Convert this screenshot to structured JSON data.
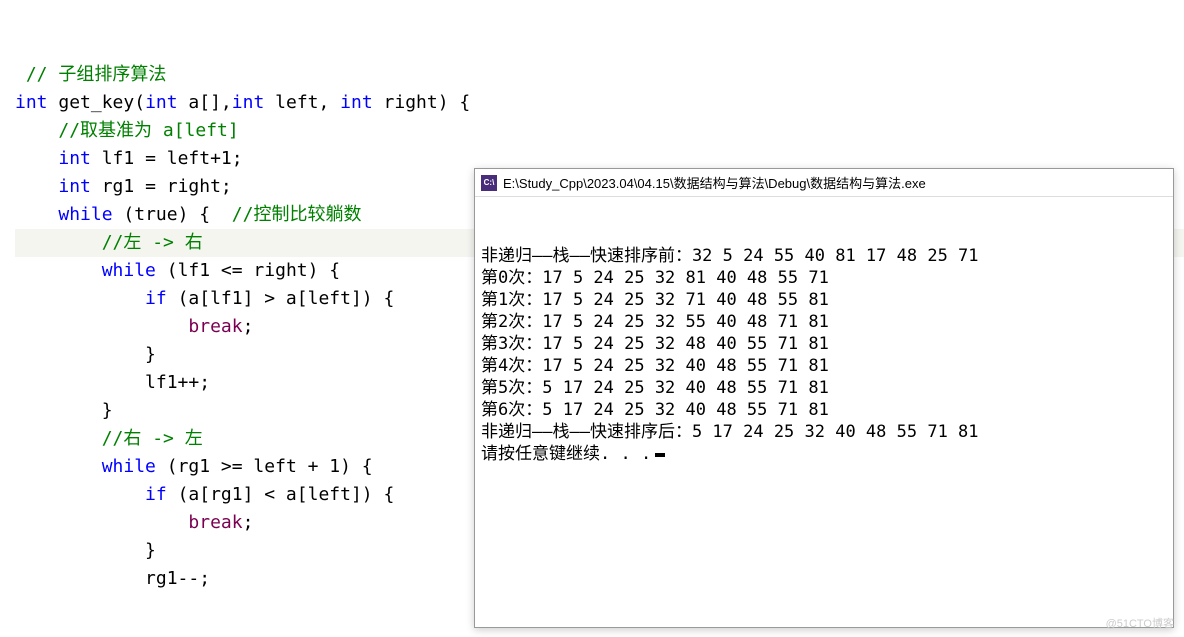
{
  "code": {
    "lines": [
      {
        "indent": 0,
        "tokens": [
          {
            "cls": "comment",
            "t": " // 子组排序算法"
          }
        ]
      },
      {
        "indent": 0,
        "tokens": [
          {
            "cls": "type",
            "t": "int "
          },
          {
            "cls": "function",
            "t": "get_key"
          },
          {
            "cls": "bracket",
            "t": "("
          },
          {
            "cls": "type",
            "t": "int "
          },
          {
            "cls": "identifier",
            "t": "a[],"
          },
          {
            "cls": "type",
            "t": "int "
          },
          {
            "cls": "identifier",
            "t": "left, "
          },
          {
            "cls": "type",
            "t": "int "
          },
          {
            "cls": "identifier",
            "t": "right) {"
          }
        ]
      },
      {
        "indent": 0,
        "tokens": [
          {
            "cls": "",
            "t": ""
          }
        ]
      },
      {
        "indent": 1,
        "tokens": [
          {
            "cls": "comment",
            "t": "//取基准为 a[left]"
          }
        ]
      },
      {
        "indent": 1,
        "tokens": [
          {
            "cls": "type",
            "t": "int "
          },
          {
            "cls": "identifier",
            "t": "lf1 = left+1;"
          }
        ]
      },
      {
        "indent": 1,
        "tokens": [
          {
            "cls": "type",
            "t": "int "
          },
          {
            "cls": "identifier",
            "t": "rg1 = right;"
          }
        ]
      },
      {
        "indent": 0,
        "tokens": [
          {
            "cls": "",
            "t": ""
          }
        ]
      },
      {
        "indent": 1,
        "tokens": [
          {
            "cls": "keyword",
            "t": "while "
          },
          {
            "cls": "identifier",
            "t": "(true) {  "
          },
          {
            "cls": "comment",
            "t": "//控制比较躺数"
          }
        ]
      },
      {
        "indent": 2,
        "highlight": true,
        "tokens": [
          {
            "cls": "comment",
            "t": "//左 -> 右"
          }
        ]
      },
      {
        "indent": 2,
        "tokens": [
          {
            "cls": "keyword",
            "t": "while "
          },
          {
            "cls": "identifier",
            "t": "(lf1 <= right) {"
          }
        ]
      },
      {
        "indent": 3,
        "tokens": [
          {
            "cls": "keyword",
            "t": "if "
          },
          {
            "cls": "identifier",
            "t": "(a[lf1] > a[left]) {"
          }
        ]
      },
      {
        "indent": 4,
        "tokens": [
          {
            "cls": "break-kw",
            "t": "break"
          },
          {
            "cls": "identifier",
            "t": ";"
          }
        ]
      },
      {
        "indent": 3,
        "tokens": [
          {
            "cls": "identifier",
            "t": "}"
          }
        ]
      },
      {
        "indent": 3,
        "tokens": [
          {
            "cls": "identifier",
            "t": "lf1++;"
          }
        ]
      },
      {
        "indent": 2,
        "tokens": [
          {
            "cls": "identifier",
            "t": "}"
          }
        ]
      },
      {
        "indent": 0,
        "tokens": [
          {
            "cls": "",
            "t": ""
          }
        ]
      },
      {
        "indent": 2,
        "tokens": [
          {
            "cls": "comment",
            "t": "//右 -> 左"
          }
        ]
      },
      {
        "indent": 2,
        "tokens": [
          {
            "cls": "keyword",
            "t": "while "
          },
          {
            "cls": "identifier",
            "t": "(rg1 >= left + 1) {"
          }
        ]
      },
      {
        "indent": 3,
        "tokens": [
          {
            "cls": "keyword",
            "t": "if "
          },
          {
            "cls": "identifier",
            "t": "(a[rg1] < a[left]) {"
          }
        ]
      },
      {
        "indent": 4,
        "tokens": [
          {
            "cls": "break-kw",
            "t": "break"
          },
          {
            "cls": "identifier",
            "t": ";"
          }
        ]
      },
      {
        "indent": 3,
        "tokens": [
          {
            "cls": "identifier",
            "t": "}"
          }
        ]
      },
      {
        "indent": 3,
        "tokens": [
          {
            "cls": "identifier",
            "t": "rg1--;"
          }
        ]
      }
    ]
  },
  "console": {
    "icon_label": "C:\\",
    "title": "E:\\Study_Cpp\\2023.04\\04.15\\数据结构与算法\\Debug\\数据结构与算法.exe",
    "lines": [
      "非递归——栈——快速排序前：32 5 24 55 40 81 17 48 25 71",
      "第0次：17 5 24 25 32 81 40 48 55 71",
      "第1次：17 5 24 25 32 71 40 48 55 81",
      "第2次：17 5 24 25 32 55 40 48 71 81",
      "第3次：17 5 24 25 32 48 40 55 71 81",
      "第4次：17 5 24 25 32 40 48 55 71 81",
      "第5次：5 17 24 25 32 40 48 55 71 81",
      "第6次：5 17 24 25 32 40 48 55 71 81",
      "非递归——栈——快速排序后：5 17 24 25 32 40 48 55 71 81",
      "请按任意键继续. . ."
    ]
  },
  "watermark": "@51CTO博客"
}
